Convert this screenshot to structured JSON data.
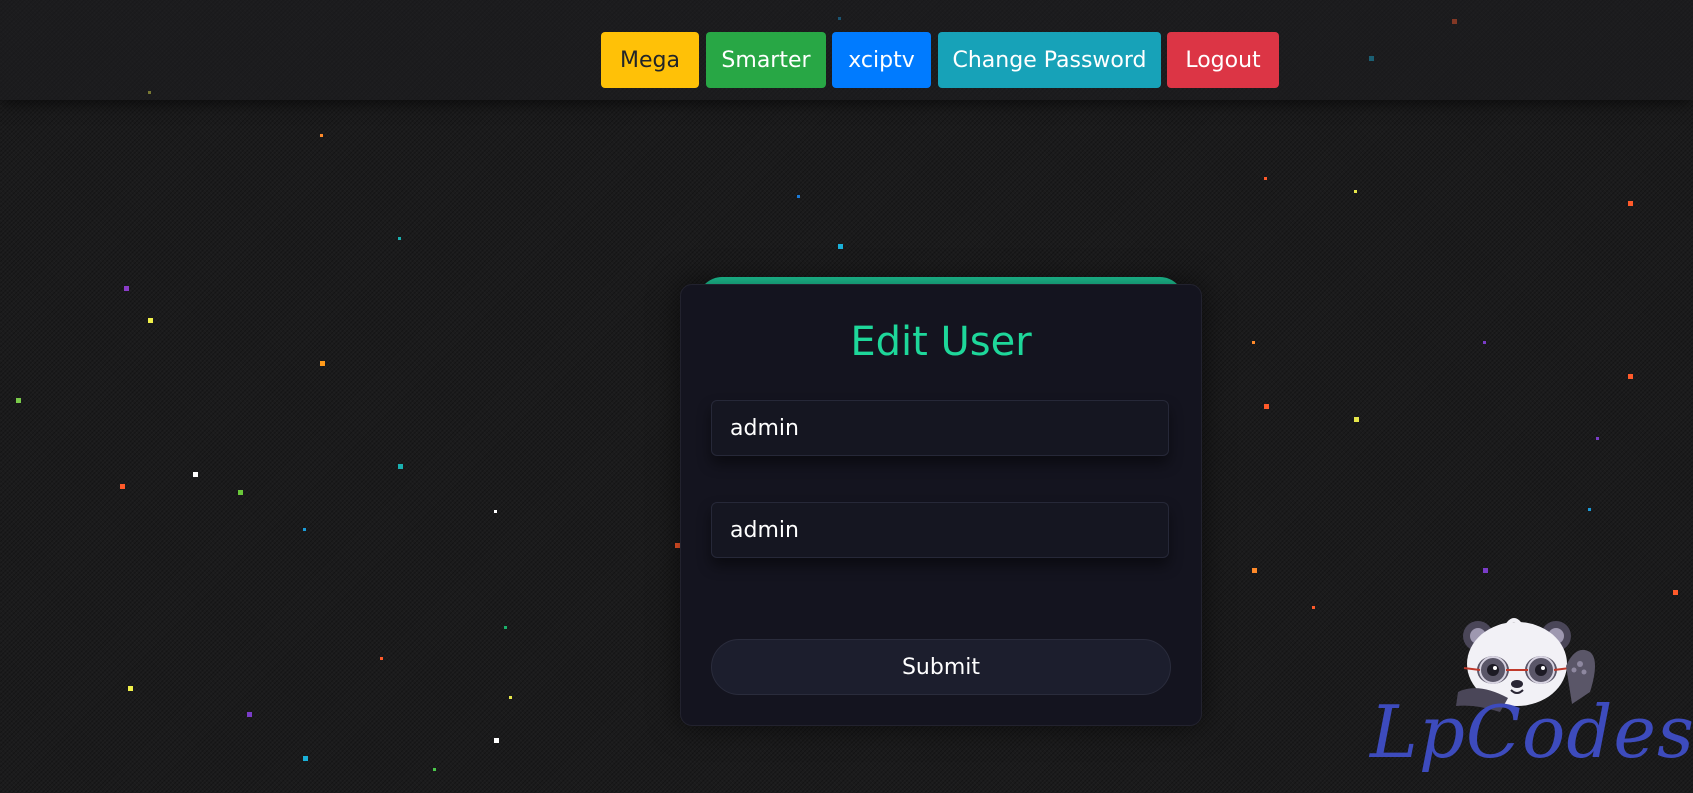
{
  "nav": {
    "buttons": [
      {
        "label": "Mega",
        "color": "#ffc107"
      },
      {
        "label": "Smarter",
        "color": "#28a745"
      },
      {
        "label": "xciptv",
        "color": "#007bff"
      },
      {
        "label": "Change Password",
        "color": "#17a2b8"
      },
      {
        "label": "Logout",
        "color": "#dc3545"
      }
    ]
  },
  "form": {
    "title": "Edit User",
    "username_value": "admin",
    "password_value": "admin",
    "submit_label": "Submit"
  },
  "logo": {
    "text": "LpCodes",
    "icon": "panda-mascot-icon"
  },
  "colors": {
    "accent": "#1ed79a",
    "background": "#1b1b1c",
    "card": "#14141f",
    "logo": "#3d4bbd"
  }
}
